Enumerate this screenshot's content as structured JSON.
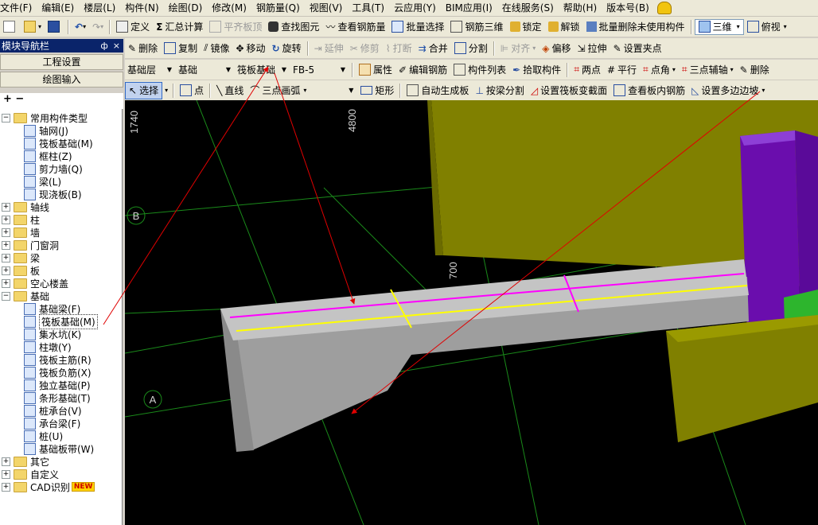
{
  "menu": [
    "文件(F)",
    "编辑(E)",
    "楼层(L)",
    "构件(N)",
    "绘图(D)",
    "修改(M)",
    "钢筋量(Q)",
    "视图(V)",
    "工具(T)",
    "云应用(Y)",
    "BIM应用(I)",
    "在线服务(S)",
    "帮助(H)",
    "版本号(B)"
  ],
  "toolbar1": {
    "define": "定义",
    "sum_calc": "汇总计算",
    "flat_top": "平齐板顶",
    "find_elem": "查找图元",
    "view_rebar_qty": "查看钢筋量",
    "batch_select": "批量选择",
    "rebar_3d": "钢筋三维",
    "lock": "锁定",
    "unlock": "解锁",
    "batch_delete_unused": "批量删除未使用构件",
    "view_3d": "三维",
    "view_top": "俯视"
  },
  "toolbar2": {
    "delete": "删除",
    "copy": "复制",
    "mirror": "镜像",
    "move": "移动",
    "rotate": "旋转",
    "extend": "延伸",
    "trim": "修剪",
    "break": "打断",
    "merge": "合并",
    "split": "分割",
    "align": "对齐",
    "offset": "偏移",
    "stretch": "拉伸",
    "set_grip": "设置夹点"
  },
  "toolbar3": {
    "floor": "基础层",
    "category": "基础",
    "type": "筏板基础",
    "name": "FB-5",
    "properties": "属性",
    "edit_rebar": "编辑钢筋",
    "component_list": "构件列表",
    "pick_component": "拾取构件",
    "two_points": "两点",
    "parallel": "平行",
    "point_angle": "点角",
    "three_point_axis": "三点辅轴",
    "delete_aux": "删除"
  },
  "toolbar4": {
    "select": "选择",
    "point": "点",
    "line": "直线",
    "arc3": "三点画弧",
    "rect": "矩形",
    "auto_slab": "自动生成板",
    "split_by_beam": "按梁分割",
    "set_section": "设置筏板变截面",
    "view_inner_rebar": "查看板内钢筋",
    "set_edge_slope": "设置多边边坡"
  },
  "left_panel": {
    "title": "模块导航栏",
    "pin": "ф",
    "close": "×",
    "btn_project": "工程设置",
    "btn_draw": "绘图输入",
    "tools": "+ −",
    "tree": [
      {
        "label": "常用构件类型",
        "level": 0,
        "expanded": true,
        "kind": "folder"
      },
      {
        "label": "轴网(J)",
        "level": 1,
        "kind": "comp"
      },
      {
        "label": "筏板基础(M)",
        "level": 1,
        "kind": "comp"
      },
      {
        "label": "框柱(Z)",
        "level": 1,
        "kind": "comp"
      },
      {
        "label": "剪力墙(Q)",
        "level": 1,
        "kind": "comp"
      },
      {
        "label": "梁(L)",
        "level": 1,
        "kind": "comp"
      },
      {
        "label": "现浇板(B)",
        "level": 1,
        "kind": "comp"
      },
      {
        "label": "轴线",
        "level": 0,
        "expanded": false,
        "kind": "folder"
      },
      {
        "label": "柱",
        "level": 0,
        "expanded": false,
        "kind": "folder"
      },
      {
        "label": "墙",
        "level": 0,
        "expanded": false,
        "kind": "folder"
      },
      {
        "label": "门窗洞",
        "level": 0,
        "expanded": false,
        "kind": "folder"
      },
      {
        "label": "梁",
        "level": 0,
        "expanded": false,
        "kind": "folder"
      },
      {
        "label": "板",
        "level": 0,
        "expanded": false,
        "kind": "folder"
      },
      {
        "label": "空心楼盖",
        "level": 0,
        "expanded": false,
        "kind": "folder"
      },
      {
        "label": "基础",
        "level": 0,
        "expanded": true,
        "kind": "folder"
      },
      {
        "label": "基础梁(F)",
        "level": 1,
        "kind": "comp"
      },
      {
        "label": "筏板基础(M)",
        "level": 1,
        "kind": "comp",
        "selected": true
      },
      {
        "label": "集水坑(K)",
        "level": 1,
        "kind": "comp"
      },
      {
        "label": "柱墩(Y)",
        "level": 1,
        "kind": "comp"
      },
      {
        "label": "筏板主筋(R)",
        "level": 1,
        "kind": "comp"
      },
      {
        "label": "筏板负筋(X)",
        "level": 1,
        "kind": "comp"
      },
      {
        "label": "独立基础(P)",
        "level": 1,
        "kind": "comp"
      },
      {
        "label": "条形基础(T)",
        "level": 1,
        "kind": "comp"
      },
      {
        "label": "桩承台(V)",
        "level": 1,
        "kind": "comp"
      },
      {
        "label": "承台梁(F)",
        "level": 1,
        "kind": "comp"
      },
      {
        "label": "桩(U)",
        "level": 1,
        "kind": "comp"
      },
      {
        "label": "基础板带(W)",
        "level": 1,
        "kind": "comp"
      },
      {
        "label": "其它",
        "level": 0,
        "expanded": false,
        "kind": "folder"
      },
      {
        "label": "自定义",
        "level": 0,
        "expanded": false,
        "kind": "folder"
      },
      {
        "label": "CAD识别",
        "level": 0,
        "expanded": false,
        "kind": "folder",
        "badge": "NEW"
      }
    ]
  },
  "viewport": {
    "dim_1740": "1740",
    "dim_4800": "4800",
    "dim_700": "700",
    "axis_b": "B",
    "axis_a": "A"
  },
  "colors": {
    "slab_top": "#c4c4c4",
    "slab_side": "#9e9e9e",
    "olive": "#808000",
    "purple": "#6a0dad",
    "green": "#2db52d",
    "magenta": "#ff00ff",
    "yellow": "#ffff00",
    "grid": "#1a8a1a",
    "annotation_arrow": "#e00000"
  }
}
